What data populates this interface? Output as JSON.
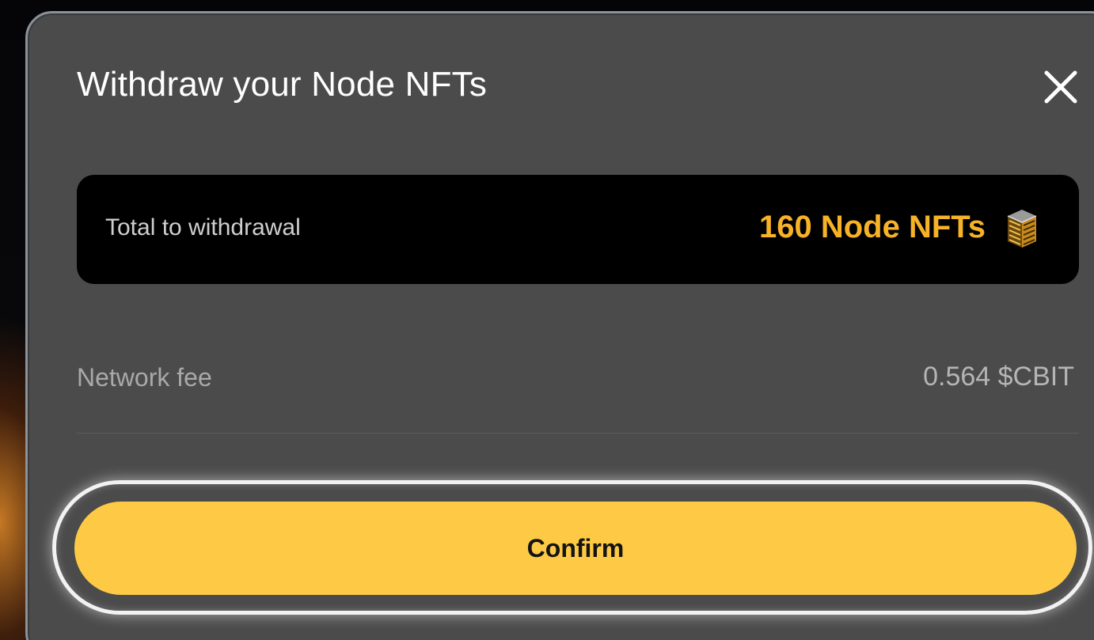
{
  "modal": {
    "title": "Withdraw your Node NFTs",
    "close_icon": "close-icon",
    "total": {
      "label": "Total to withdrawal",
      "value": "160 Node NFTs",
      "icon": "node-nft-icon"
    },
    "fee": {
      "label": "Network fee",
      "value": "0.564 $CBIT"
    },
    "confirm_label": "Confirm"
  },
  "colors": {
    "accent": "#fec945",
    "value_text": "#f7b227",
    "modal_bg": "#4b4b4b",
    "panel_bg": "#000000"
  }
}
